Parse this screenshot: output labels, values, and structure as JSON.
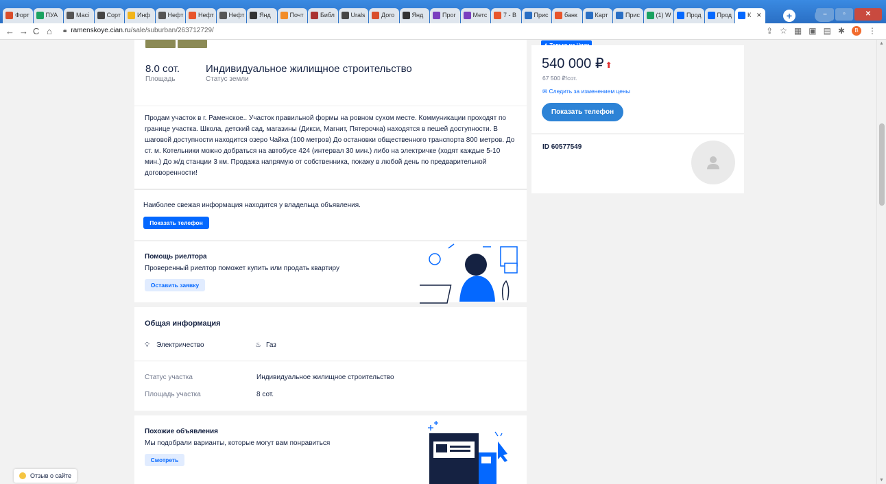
{
  "browser": {
    "tabs": [
      {
        "label": "Форт",
        "color": "#d94d2b"
      },
      {
        "label": "ПУА",
        "color": "#1aa260"
      },
      {
        "label": "Масі",
        "color": "#555555"
      },
      {
        "label": "Сорт",
        "color": "#444444"
      },
      {
        "label": "Инф",
        "color": "#f2b51b"
      },
      {
        "label": "Нефт",
        "color": "#555555"
      },
      {
        "label": "Нефт",
        "color": "#e8552b"
      },
      {
        "label": "Нефт",
        "color": "#555555"
      },
      {
        "label": "Янд",
        "color": "#333333"
      },
      {
        "label": "Почт",
        "color": "#f28c28"
      },
      {
        "label": "Библ",
        "color": "#a33"
      },
      {
        "label": "Urals",
        "color": "#444444"
      },
      {
        "label": "Дого",
        "color": "#d94d2b"
      },
      {
        "label": "Янд",
        "color": "#333333"
      },
      {
        "label": "Прог",
        "color": "#7b3fbf"
      },
      {
        "label": "Метс",
        "color": "#7b3fbf"
      },
      {
        "label": "7 - В",
        "color": "#e8552b"
      },
      {
        "label": "Прис",
        "color": "#2a6fc4"
      },
      {
        "label": "банк",
        "color": "#e8552b"
      },
      {
        "label": "Карт",
        "color": "#2a6fc4"
      },
      {
        "label": "Прис",
        "color": "#2a6fc4"
      },
      {
        "label": "(1) W",
        "color": "#1aa260"
      },
      {
        "label": "Прод",
        "color": "#0468ff"
      },
      {
        "label": "Прод",
        "color": "#0468ff"
      },
      {
        "label": "К",
        "color": "#0468ff"
      }
    ],
    "url_host": "ramenskoye.cian.ru",
    "url_path": "/sale/suburban/263712729/",
    "profile_initial": "В"
  },
  "listing": {
    "area_value": "8.0 сот.",
    "area_label": "Площадь",
    "land_status_value": "Индивидуальное жилищное строительство",
    "land_status_label": "Статус земли",
    "description": "Продам участок в г. Раменское.. Участок правильной формы на ровном сухом месте. Коммуникации проходят по границе участка. Школа, детский сад, магазины (Дикси, Магнит, Пятерочка) находятся в пешей доступности.  В шаговой доступности находится озеро Чайка (100 метров) До остановки общественного транспорта 800 метров. До ст. м. Котельники можно добраться на автобусе  424 (интервал 30 мин.) либо на электричке (ходят каждые 5-10 мин.) До ж/д станции 3 км. Продажа напрямую от собственника, покажу в любой день по предварительной договоренности!",
    "fresh_info_text": "Наиболее свежая информация находится у владельца объявления.",
    "show_phone_label": "Показать телефон"
  },
  "realtor": {
    "title": "Помощь риелтора",
    "subtitle": "Проверенный риелтор поможет купить или продать квартиру",
    "button": "Оставить заявку"
  },
  "general_info": {
    "title": "Общая информация",
    "utility_1": "Электричество",
    "utility_2": "Газ",
    "rows": [
      {
        "label": "Статус участка",
        "value": "Индивидуальное жилищное строительство"
      },
      {
        "label": "Площадь участка",
        "value": "8 сот."
      }
    ]
  },
  "similar": {
    "title": "Похожие объявления",
    "subtitle": "Мы подобрали варианты, которые могут вам понравиться",
    "button": "Смотреть"
  },
  "sidebar": {
    "badge": "Только на Циан",
    "price": "540 000 ₽",
    "price_per_unit": "67 500 ₽/сот.",
    "track_price": "Следить за изменением цены",
    "show_phone": "Показать телефон",
    "listing_id": "ID 60577549"
  },
  "feedback": "Отзыв о сайте",
  "colors": {
    "accent": "#0468ff",
    "price_up": "#e03030"
  }
}
